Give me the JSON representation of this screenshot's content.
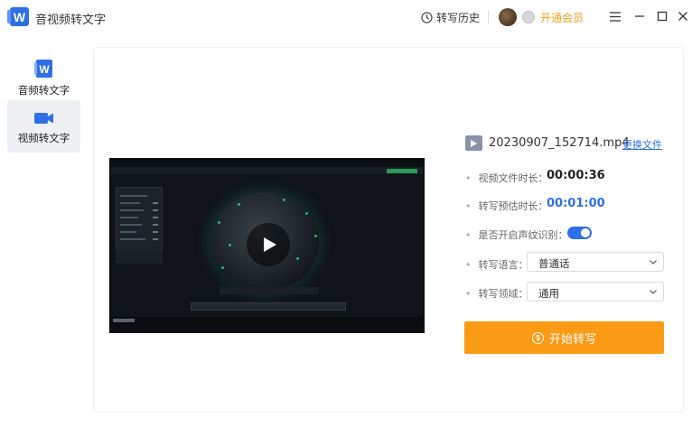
{
  "app": {
    "title": "音视频转文字",
    "logo_letter": "W"
  },
  "header": {
    "history_label": "转写历史",
    "vip_label": "开通会员"
  },
  "sidebar": {
    "items": [
      {
        "label": "音频转文字",
        "icon": "audio-doc-icon",
        "active": false
      },
      {
        "label": "视频转文字",
        "icon": "video-camera-icon",
        "active": true
      }
    ]
  },
  "file": {
    "name": "20230907_152714.mp4",
    "change_label": "更换文件"
  },
  "details": {
    "duration_label": "视频文件时长：",
    "duration_value": "00:00:36",
    "estimate_label": "转写预估时长：",
    "estimate_value": "00:01:00",
    "voiceprint_label": "是否开启声纹识别：",
    "voiceprint_on": true,
    "language_label": "转写语言：",
    "language_value": "普通话",
    "domain_label": "转写领域：",
    "domain_value": "通用"
  },
  "actions": {
    "start_label": "开始转写"
  },
  "colors": {
    "accent": "#2f6fe4",
    "start_button": "#fb9a14",
    "vip": "#f0a020"
  }
}
